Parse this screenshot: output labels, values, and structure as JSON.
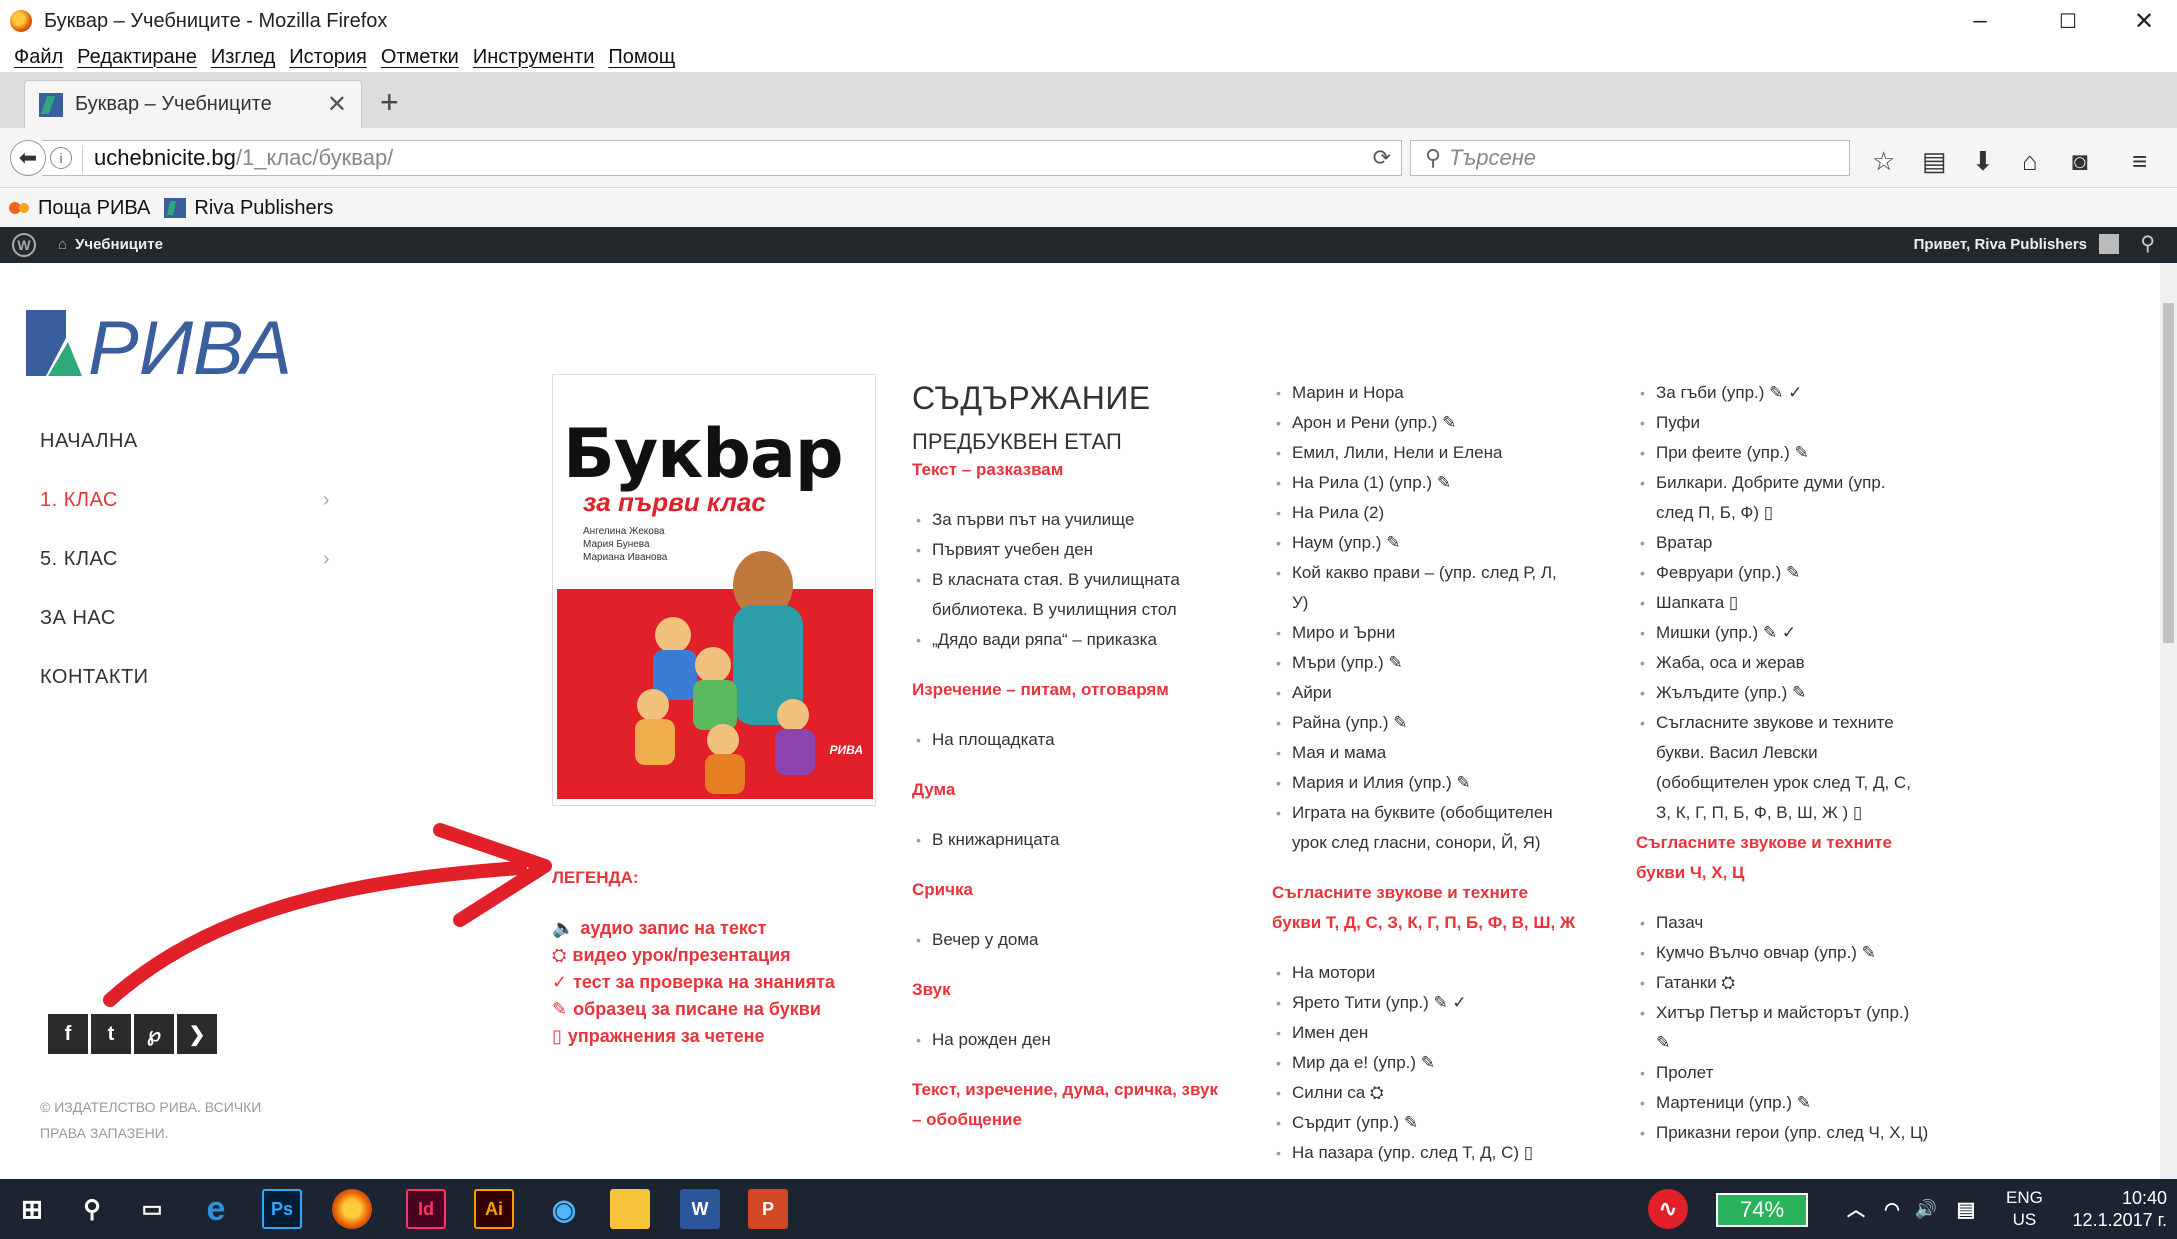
{
  "window": {
    "title": "Буквар – Учебниците - Mozilla Firefox",
    "minimize": "–",
    "maximize": "☐",
    "close": "✕"
  },
  "menu": [
    "Файл",
    "Редактиране",
    "Изглед",
    "История",
    "Отметки",
    "Инструменти",
    "Помощ"
  ],
  "tab": {
    "label": "Буквар – Учебниците",
    "close": "✕",
    "new": "+"
  },
  "url": {
    "host": "uchebnicite.bg",
    "path": "/1_клас/буквар/"
  },
  "search": {
    "placeholder": "Търсене"
  },
  "bookmarks": [
    "Поща РИВА",
    "Riva Publishers"
  ],
  "wp": {
    "site": "Учебниците",
    "greeting": "Привет, Riva Publishers"
  },
  "sidebar": {
    "logo": "РИВА",
    "nav": [
      {
        "label": "Начална",
        "active": false,
        "chevron": false
      },
      {
        "label": "1. клас",
        "active": true,
        "chevron": true
      },
      {
        "label": "5. клас",
        "active": false,
        "chevron": true
      },
      {
        "label": "За нас",
        "active": false,
        "chevron": false
      },
      {
        "label": "Контакти",
        "active": false,
        "chevron": false
      }
    ],
    "social": [
      "f",
      "t",
      "℘",
      "❯"
    ],
    "copyright": "© Издателство РИВА. Всички права запазени."
  },
  "cover": {
    "title": "Букbар",
    "subtitle": "за първи клас",
    "authors": "Ангелина Жекова\nМария Бунева\nМариана Иванова",
    "publisher": "РИВА"
  },
  "legend": {
    "heading": "ЛЕГЕНДА:",
    "items": [
      {
        "glyph": "🔈",
        "label": "аудио запис на текст"
      },
      {
        "glyph": "⛭",
        "label": "видео урок/презентация"
      },
      {
        "glyph": "✓",
        "label": "тест за проверка на знанията"
      },
      {
        "glyph": "✎",
        "label": "образец за писане на букви"
      },
      {
        "glyph": "▯",
        "label": "упражнения за четене"
      }
    ]
  },
  "content": {
    "heading": "Съдържание",
    "subheading": "Предбуквен етап",
    "col1": [
      {
        "t": "sect",
        "text": "Текст – разказвам"
      },
      {
        "t": "gap"
      },
      {
        "t": "item",
        "text": "За първи път на училище"
      },
      {
        "t": "item",
        "text": "Първият учебен ден"
      },
      {
        "t": "item",
        "text": "В класната стая. В училищната"
      },
      {
        "t": "cont",
        "text": "библиотека. В училищния стол"
      },
      {
        "t": "item",
        "text": "„Дядо вади ряпа“ – приказка"
      },
      {
        "t": "gap"
      },
      {
        "t": "sect",
        "text": "Изречение – питам, отговарям"
      },
      {
        "t": "gap"
      },
      {
        "t": "item",
        "text": "На площадката"
      },
      {
        "t": "gap"
      },
      {
        "t": "sect",
        "text": "Дума"
      },
      {
        "t": "gap"
      },
      {
        "t": "item",
        "text": "В книжарницата"
      },
      {
        "t": "gap"
      },
      {
        "t": "sect",
        "text": "Сричка"
      },
      {
        "t": "gap"
      },
      {
        "t": "item",
        "text": "Вечер у дома"
      },
      {
        "t": "gap"
      },
      {
        "t": "sect",
        "text": "Звук"
      },
      {
        "t": "gap"
      },
      {
        "t": "item",
        "text": "На рожден ден"
      },
      {
        "t": "gap"
      },
      {
        "t": "sect",
        "text": "Текст, изречение, дума, сричка, звук"
      },
      {
        "t": "sect",
        "text": "– обобщение"
      }
    ],
    "col2": [
      {
        "t": "item",
        "text": "Марин и Нора"
      },
      {
        "t": "item",
        "text": "Арон и Рени (упр.) ✎"
      },
      {
        "t": "item",
        "text": "Емил, Лили, Нели и Елена"
      },
      {
        "t": "item",
        "text": "На Рила (1) (упр.) ✎"
      },
      {
        "t": "item",
        "text": "На Рила (2)"
      },
      {
        "t": "item",
        "text": "Наум (упр.) ✎"
      },
      {
        "t": "item",
        "text": "Кой какво прави – (упр. след Р, Л,"
      },
      {
        "t": "cont",
        "text": "У)"
      },
      {
        "t": "item",
        "text": "Миро и Ърни"
      },
      {
        "t": "item",
        "text": "Мъри (упр.) ✎"
      },
      {
        "t": "item",
        "text": "Айри"
      },
      {
        "t": "item",
        "text": "Райна (упр.) ✎"
      },
      {
        "t": "item",
        "text": "Мая и мама"
      },
      {
        "t": "item",
        "text": "Мария и Илия (упр.) ✎"
      },
      {
        "t": "item",
        "text": "Играта на буквите (обобщителен"
      },
      {
        "t": "cont",
        "text": "урок след гласни, сонори, Й, Я)"
      },
      {
        "t": "gap"
      },
      {
        "t": "sect",
        "text": "Съгласните звукове и техните"
      },
      {
        "t": "sect",
        "text": "букви Т, Д, С, З, К, Г, П, Б, Ф, В, Ш, Ж"
      },
      {
        "t": "gap"
      },
      {
        "t": "item",
        "text": "На мотори"
      },
      {
        "t": "item",
        "text": "Ярето Тити (упр.) ✎ ✓"
      },
      {
        "t": "item",
        "text": "Имен ден"
      },
      {
        "t": "item",
        "text": "Мир да е! (упр.) ✎"
      },
      {
        "t": "item",
        "text": "Силни са ⛭"
      },
      {
        "t": "item",
        "text": "Сърдит (упр.) ✎"
      },
      {
        "t": "item",
        "text": "На пазара (упр. след Т, Д, С) ▯"
      }
    ],
    "col3": [
      {
        "t": "item",
        "text": "За гъби (упр.) ✎ ✓"
      },
      {
        "t": "item",
        "text": "Пуфи"
      },
      {
        "t": "item",
        "text": "При феите (упр.) ✎"
      },
      {
        "t": "item",
        "text": "Билкари. Добрите думи (упр."
      },
      {
        "t": "cont",
        "text": "след П, Б, Ф) ▯"
      },
      {
        "t": "item",
        "text": "Вратар"
      },
      {
        "t": "item",
        "text": "Февруари (упр.) ✎"
      },
      {
        "t": "item",
        "text": "Шапката ▯"
      },
      {
        "t": "item",
        "text": "Мишки (упр.) ✎ ✓"
      },
      {
        "t": "item",
        "text": "Жаба, оса и жерав"
      },
      {
        "t": "item",
        "text": "Жълъдите (упр.) ✎"
      },
      {
        "t": "item",
        "text": "Съгласните звукове и техните"
      },
      {
        "t": "cont",
        "text": "букви. Васил Левски"
      },
      {
        "t": "cont",
        "text": "(обобщителен урок след Т, Д, С,"
      },
      {
        "t": "cont",
        "text": "З, К, Г, П, Б, Ф, В, Ш, Ж ) ▯"
      },
      {
        "t": "sect",
        "text": "Съгласните звукове и техните"
      },
      {
        "t": "sect",
        "text": "букви Ч, Х, Ц"
      },
      {
        "t": "gap"
      },
      {
        "t": "item",
        "text": "Пазач"
      },
      {
        "t": "item",
        "text": "Кумчо Вълчо овчар (упр.) ✎"
      },
      {
        "t": "item",
        "text": "Гатанки ⛭"
      },
      {
        "t": "item",
        "text": "Хитър Петър и майсторът (упр.)"
      },
      {
        "t": "cont",
        "text": "✎"
      },
      {
        "t": "item",
        "text": "Пролет"
      },
      {
        "t": "item",
        "text": "Мартеници (упр.) ✎"
      },
      {
        "t": "item",
        "text": "Приказни герои (упр. след Ч, Х, Ц)"
      }
    ]
  },
  "taskbar": {
    "battery": "74%",
    "lang_top": "ENG",
    "lang_bottom": "US",
    "time": "10:40",
    "date": "12.1.2017 г."
  },
  "colors": {
    "accent": "#e8343a",
    "wpbar": "#23282d",
    "taskbar": "#1b2430"
  }
}
